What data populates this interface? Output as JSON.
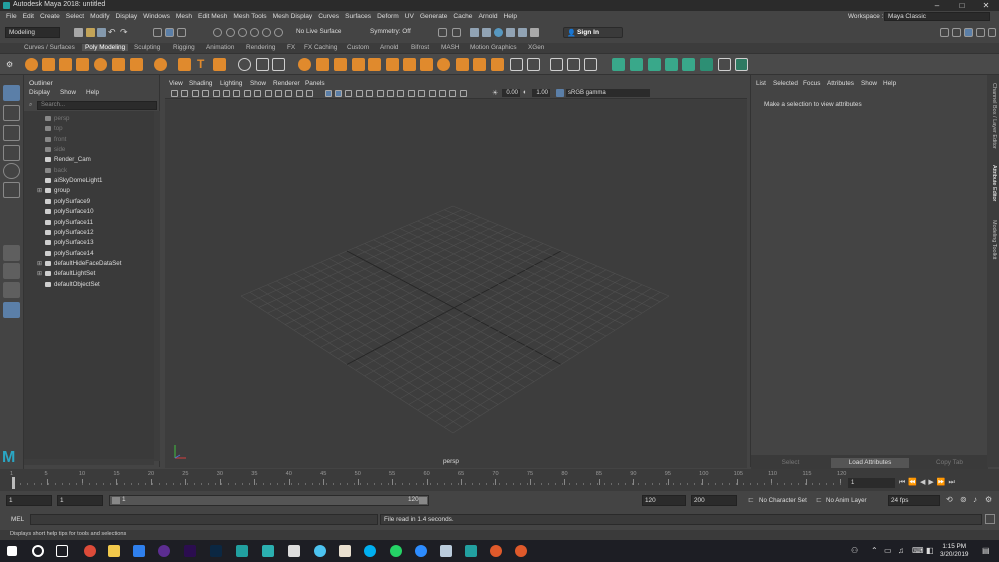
{
  "titlebar": {
    "title": "Autodesk Maya 2018: untitled",
    "min": "–",
    "max": "□",
    "close": "✕"
  },
  "menubar": {
    "items": [
      "File",
      "Edit",
      "Create",
      "Select",
      "Modify",
      "Display",
      "Windows",
      "Mesh",
      "Edit Mesh",
      "Mesh Tools",
      "Mesh Display",
      "Curves",
      "Surfaces",
      "Deform",
      "UV",
      "Generate",
      "Cache",
      "Arnold",
      "Help"
    ],
    "workspace_label": "Workspace :",
    "workspace_value": "Maya Classic"
  },
  "statusline": {
    "mode": "Modeling",
    "live_surface": "No Live Surface",
    "symmetry": "Symmetry: Off",
    "sign_in": "Sign In"
  },
  "shelf_tabs": [
    "Curves / Surfaces",
    "Poly Modeling",
    "Sculpting",
    "Rigging",
    "Animation",
    "Rendering",
    "FX",
    "FX Caching",
    "Custom",
    "Arnold",
    "Bifrost",
    "MASH",
    "Motion Graphics",
    "XGen"
  ],
  "shelf_active_tab": "Poly Modeling",
  "outliner": {
    "title": "Outliner",
    "menu": [
      "Display",
      "Show",
      "Help"
    ],
    "search_placeholder": "Search...",
    "items": [
      {
        "label": "persp",
        "dim": true
      },
      {
        "label": "top",
        "dim": true
      },
      {
        "label": "front",
        "dim": true
      },
      {
        "label": "side",
        "dim": true
      },
      {
        "label": "Render_Cam",
        "dim": false
      },
      {
        "label": "back",
        "dim": true
      },
      {
        "label": "aiSkyDomeLight1",
        "dim": false
      },
      {
        "label": "group",
        "dim": false,
        "expandable": true
      },
      {
        "label": "polySurface9",
        "dim": false
      },
      {
        "label": "polySurface10",
        "dim": false
      },
      {
        "label": "polySurface11",
        "dim": false
      },
      {
        "label": "polySurface12",
        "dim": false
      },
      {
        "label": "polySurface13",
        "dim": false
      },
      {
        "label": "polySurface14",
        "dim": false
      },
      {
        "label": "defaultHideFaceDataSet",
        "dim": false,
        "expandable": true
      },
      {
        "label": "defaultLightSet",
        "dim": false,
        "expandable": true
      },
      {
        "label": "defaultObjectSet",
        "dim": false
      }
    ]
  },
  "viewport": {
    "menu": [
      "View",
      "Shading",
      "Lighting",
      "Show",
      "Renderer",
      "Panels"
    ],
    "exposure": "0.00",
    "gamma": "1.00",
    "color_space": "sRGB gamma",
    "camera": "persp"
  },
  "attribute_editor": {
    "menu": [
      "List",
      "Selected",
      "Focus",
      "Attributes",
      "Show",
      "Help"
    ],
    "message": "Make a selection to view attributes",
    "buttons": [
      "Select",
      "Load Attributes",
      "Copy Tab"
    ]
  },
  "side_tabs": [
    "Channel Box / Layer Editor",
    "Attribute Editor",
    "Modeling Toolkit"
  ],
  "timeslider": {
    "ticks": [
      "1",
      "5",
      "10",
      "15",
      "20",
      "25",
      "30",
      "35",
      "40",
      "45",
      "50",
      "55",
      "60",
      "65",
      "70",
      "75",
      "80",
      "85",
      "90",
      "95",
      "100",
      "105",
      "110",
      "115",
      "120"
    ],
    "current_frame": "1"
  },
  "range": {
    "start": "1",
    "start2": "1",
    "slider_start": "1",
    "slider_end": "120",
    "end": "120",
    "end2": "200",
    "char_set": "No Character Set",
    "anim_layer": "No Anim Layer",
    "fps": "24 fps"
  },
  "cmdline": {
    "lang": "MEL",
    "result": "File read in  1.4 seconds."
  },
  "helpline": "Displays short help tips for tools and selections",
  "taskbar": {
    "time": "1:15 PM",
    "date": "3/20/2019"
  }
}
